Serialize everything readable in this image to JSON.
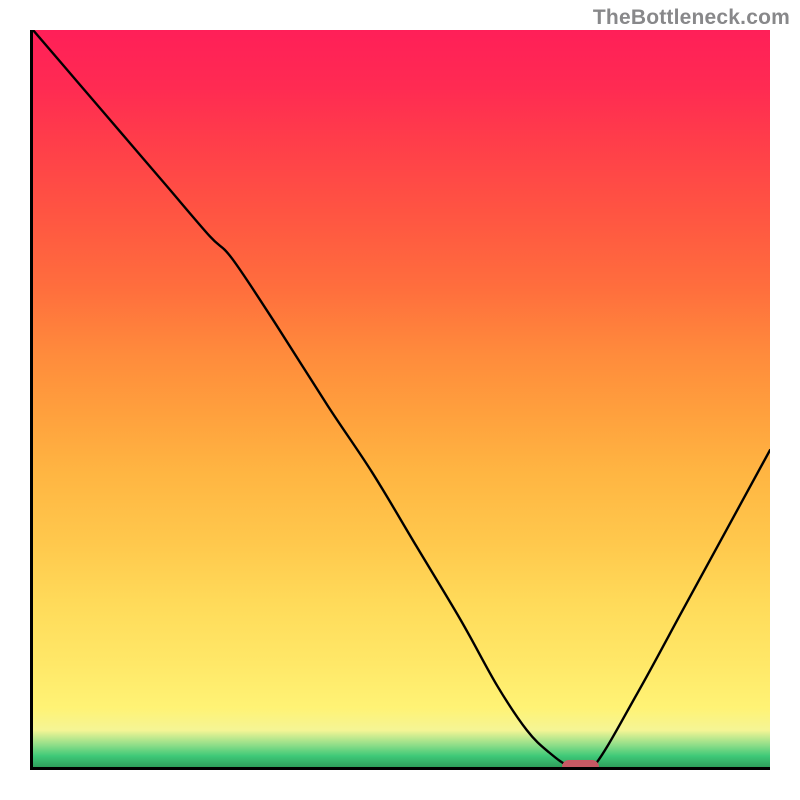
{
  "watermark": "TheBottleneck.com",
  "chart_data": {
    "type": "line",
    "title": "",
    "xlabel": "",
    "ylabel": "",
    "xlim": [
      0,
      100
    ],
    "ylim": [
      0,
      100
    ],
    "grid": false,
    "series": [
      {
        "name": "bottleneck-curve",
        "x": [
          0,
          6,
          12,
          18,
          24,
          27,
          33,
          40,
          46,
          52,
          58,
          63,
          67,
          70,
          73,
          76,
          82,
          88,
          94,
          100
        ],
        "values": [
          100,
          93,
          86,
          79,
          72,
          69,
          60,
          49,
          40,
          30,
          20,
          11,
          5,
          2,
          0,
          0,
          10,
          21,
          32,
          43
        ]
      }
    ],
    "marker": {
      "x": 74,
      "y": 0,
      "width_pct": 5.0,
      "color": "#c75963"
    },
    "background_gradient": {
      "orientation": "vertical",
      "stops": [
        {
          "pos": 0,
          "color": "#2e9f5b"
        },
        {
          "pos": 1.5,
          "color": "#3fc978"
        },
        {
          "pos": 3,
          "color": "#8fde89"
        },
        {
          "pos": 5,
          "color": "#f5f595"
        },
        {
          "pos": 8,
          "color": "#fff375"
        },
        {
          "pos": 14,
          "color": "#ffe868"
        },
        {
          "pos": 22,
          "color": "#ffdb5a"
        },
        {
          "pos": 30,
          "color": "#ffc94d"
        },
        {
          "pos": 40,
          "color": "#ffb542"
        },
        {
          "pos": 48,
          "color": "#ffa03d"
        },
        {
          "pos": 56,
          "color": "#ff8b3c"
        },
        {
          "pos": 65,
          "color": "#ff6e3d"
        },
        {
          "pos": 75,
          "color": "#ff5542"
        },
        {
          "pos": 85,
          "color": "#ff3d4a"
        },
        {
          "pos": 92,
          "color": "#ff2b52"
        },
        {
          "pos": 100,
          "color": "#ff1f58"
        }
      ]
    }
  }
}
